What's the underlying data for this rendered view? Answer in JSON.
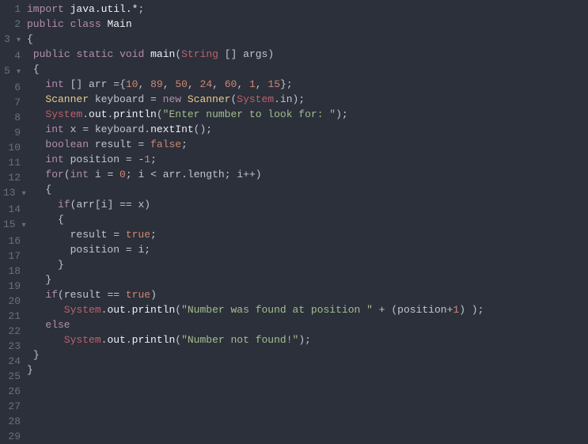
{
  "gutter": [
    "1",
    "2",
    "3",
    "4",
    "5",
    "6",
    "7",
    "8",
    "9",
    "10",
    "11",
    "12",
    "13",
    "14",
    "15",
    "16",
    "17",
    "18",
    "19",
    "20",
    "21",
    "22",
    "23",
    "24",
    "25",
    "26",
    "27",
    "28",
    "29"
  ],
  "fold_lines": [
    3,
    5,
    13,
    15
  ],
  "code": {
    "l1": {
      "import": "import",
      "pkg": "java.util.*",
      "semi": ";"
    },
    "l2": {
      "public": "public",
      "class": "class",
      "name": "Main"
    },
    "l3": {
      "brace": "{"
    },
    "l4": {
      "public": "public",
      "static": "static",
      "void": "void",
      "main": "main",
      "lp": "(",
      "String": "String",
      "brackets": " [] ",
      "args": "args",
      "rp": ")"
    },
    "l5": {
      "brace": "{"
    },
    "l6": {
      "int": "int",
      "brackets": " [] ",
      "arr": "arr ",
      "eq": "=",
      "lb": "{",
      "n1": "10",
      "c": ", ",
      "n2": "89",
      "n3": "50",
      "n4": "24",
      "n5": "60",
      "n6": "1",
      "n7": "15",
      "rb": "}",
      "semi": ";"
    },
    "l7": {
      "Scanner1": "Scanner",
      "kb": " keyboard ",
      "eq": "= ",
      "new": "new",
      "Scanner2": " Scanner",
      "lp": "(",
      "System": "System",
      "dot": ".",
      "in": "in",
      "rp": ")",
      "semi": ";"
    },
    "l8": {
      "System": "System",
      "dot1": ".",
      "out": "out",
      "dot2": ".",
      "println": "println",
      "lp": "(",
      "str": "\"Enter number to look for: \"",
      "rp": ")",
      "semi": ";"
    },
    "l9": {
      "int": "int",
      "x": " x ",
      "eq": "= ",
      "kb": "keyboard",
      "dot": ".",
      "nextInt": "nextInt",
      "lp": "(",
      "rp": ")",
      "semi": ";"
    },
    "l10": {
      "boolean": "boolean",
      "result": " result ",
      "eq": "= ",
      "false": "false",
      "semi": ";"
    },
    "l11": {
      "int": "int",
      "position": " position ",
      "eq": "= ",
      "neg": "-",
      "one": "1",
      "semi": ";"
    },
    "l12": {
      "for": "for",
      "lp": "(",
      "int": "int",
      "i": " i ",
      "eq": "= ",
      "zero": "0",
      "semi1": "; ",
      "i2": "i ",
      "lt": "< ",
      "arr": "arr",
      "dot": ".",
      "length": "length",
      "semi2": "; ",
      "i3": "i",
      "inc": "++",
      "rp": ")"
    },
    "l13": {
      "brace": "{"
    },
    "l14": {
      "if": "if",
      "lp": "(",
      "arr": "arr",
      "lb": "[",
      "i": "i",
      "rb": "] ",
      "eqeq": "== ",
      "x": "x",
      "rp": ")"
    },
    "l15": {
      "brace": "{"
    },
    "l16": {
      "result": "result ",
      "eq": "= ",
      "true": "true",
      "semi": ";"
    },
    "l17": {
      "position": "position ",
      "eq": "= ",
      "i": "i",
      "semi": ";"
    },
    "l18": {
      "brace": "}"
    },
    "l19": {
      "blank": ""
    },
    "l20": {
      "brace": "}"
    },
    "l21": {
      "if": "if",
      "lp": "(",
      "result": "result ",
      "eqeq": "== ",
      "true": "true",
      "rp": ")"
    },
    "l22": {
      "System": "System",
      "dot1": ".",
      "out": "out",
      "dot2": ".",
      "println": "println",
      "lp": "(",
      "str": "\"Number was found at position \"",
      "plus": " + ",
      "lp2": "(",
      "position": "position",
      "plus2": "+",
      "one": "1",
      "rp2": ") ",
      "rp": ")",
      "semi": ";"
    },
    "l23": {
      "else": "else"
    },
    "l24": {
      "System": "System",
      "dot1": ".",
      "out": "out",
      "dot2": ".",
      "println": "println",
      "lp": "(",
      "str": "\"Number not found!\"",
      "rp": ")",
      "semi": ";"
    },
    "l25": {
      "blank": ""
    },
    "l26": {
      "brace": "}"
    },
    "l27": {
      "blank": ""
    },
    "l28": {
      "brace": "}"
    },
    "l29": {
      "blank": ""
    }
  }
}
